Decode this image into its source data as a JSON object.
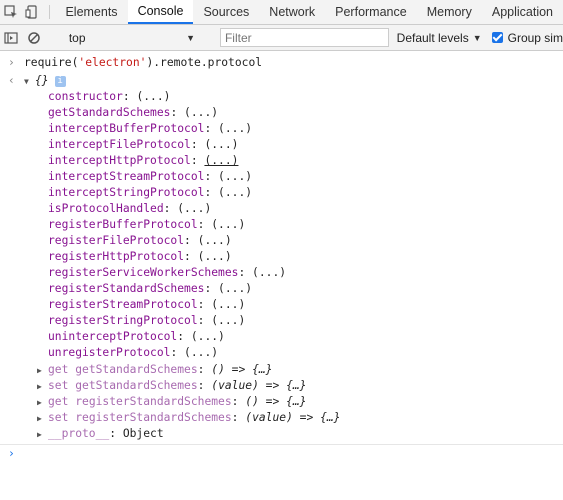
{
  "tabs": [
    "Elements",
    "Console",
    "Sources",
    "Network",
    "Performance",
    "Memory",
    "Application"
  ],
  "active_tab": "Console",
  "toolbar": {
    "context_value": "top",
    "filter_placeholder": "Filter",
    "levels_label": "Default levels",
    "group_label": "Group sim"
  },
  "command": {
    "prefix": "require(",
    "arg": "'electron'",
    "suffix": ").remote.protocol"
  },
  "object_label": "{}",
  "info_badge": "i",
  "methods": [
    "constructor",
    "getStandardSchemes",
    "interceptBufferProtocol",
    "interceptFileProtocol",
    "interceptHttpProtocol",
    "interceptStreamProtocol",
    "interceptStringProtocol",
    "isProtocolHandled",
    "registerBufferProtocol",
    "registerFileProtocol",
    "registerHttpProtocol",
    "registerServiceWorkerSchemes",
    "registerStandardSchemes",
    "registerStreamProtocol",
    "registerStringProtocol",
    "uninterceptProtocol",
    "unregisterProtocol"
  ],
  "collapsed_value": "(...)",
  "accessors": [
    {
      "prefix": "get",
      "name": "getStandardSchemes",
      "sig": "() => {…}"
    },
    {
      "prefix": "set",
      "name": "getStandardSchemes",
      "sig": "(value) => {…}"
    },
    {
      "prefix": "get",
      "name": "registerStandardSchemes",
      "sig": "() => {…}"
    },
    {
      "prefix": "set",
      "name": "registerStandardSchemes",
      "sig": "(value) => {…}"
    }
  ],
  "proto": {
    "name": "__proto__",
    "value": "Object"
  }
}
